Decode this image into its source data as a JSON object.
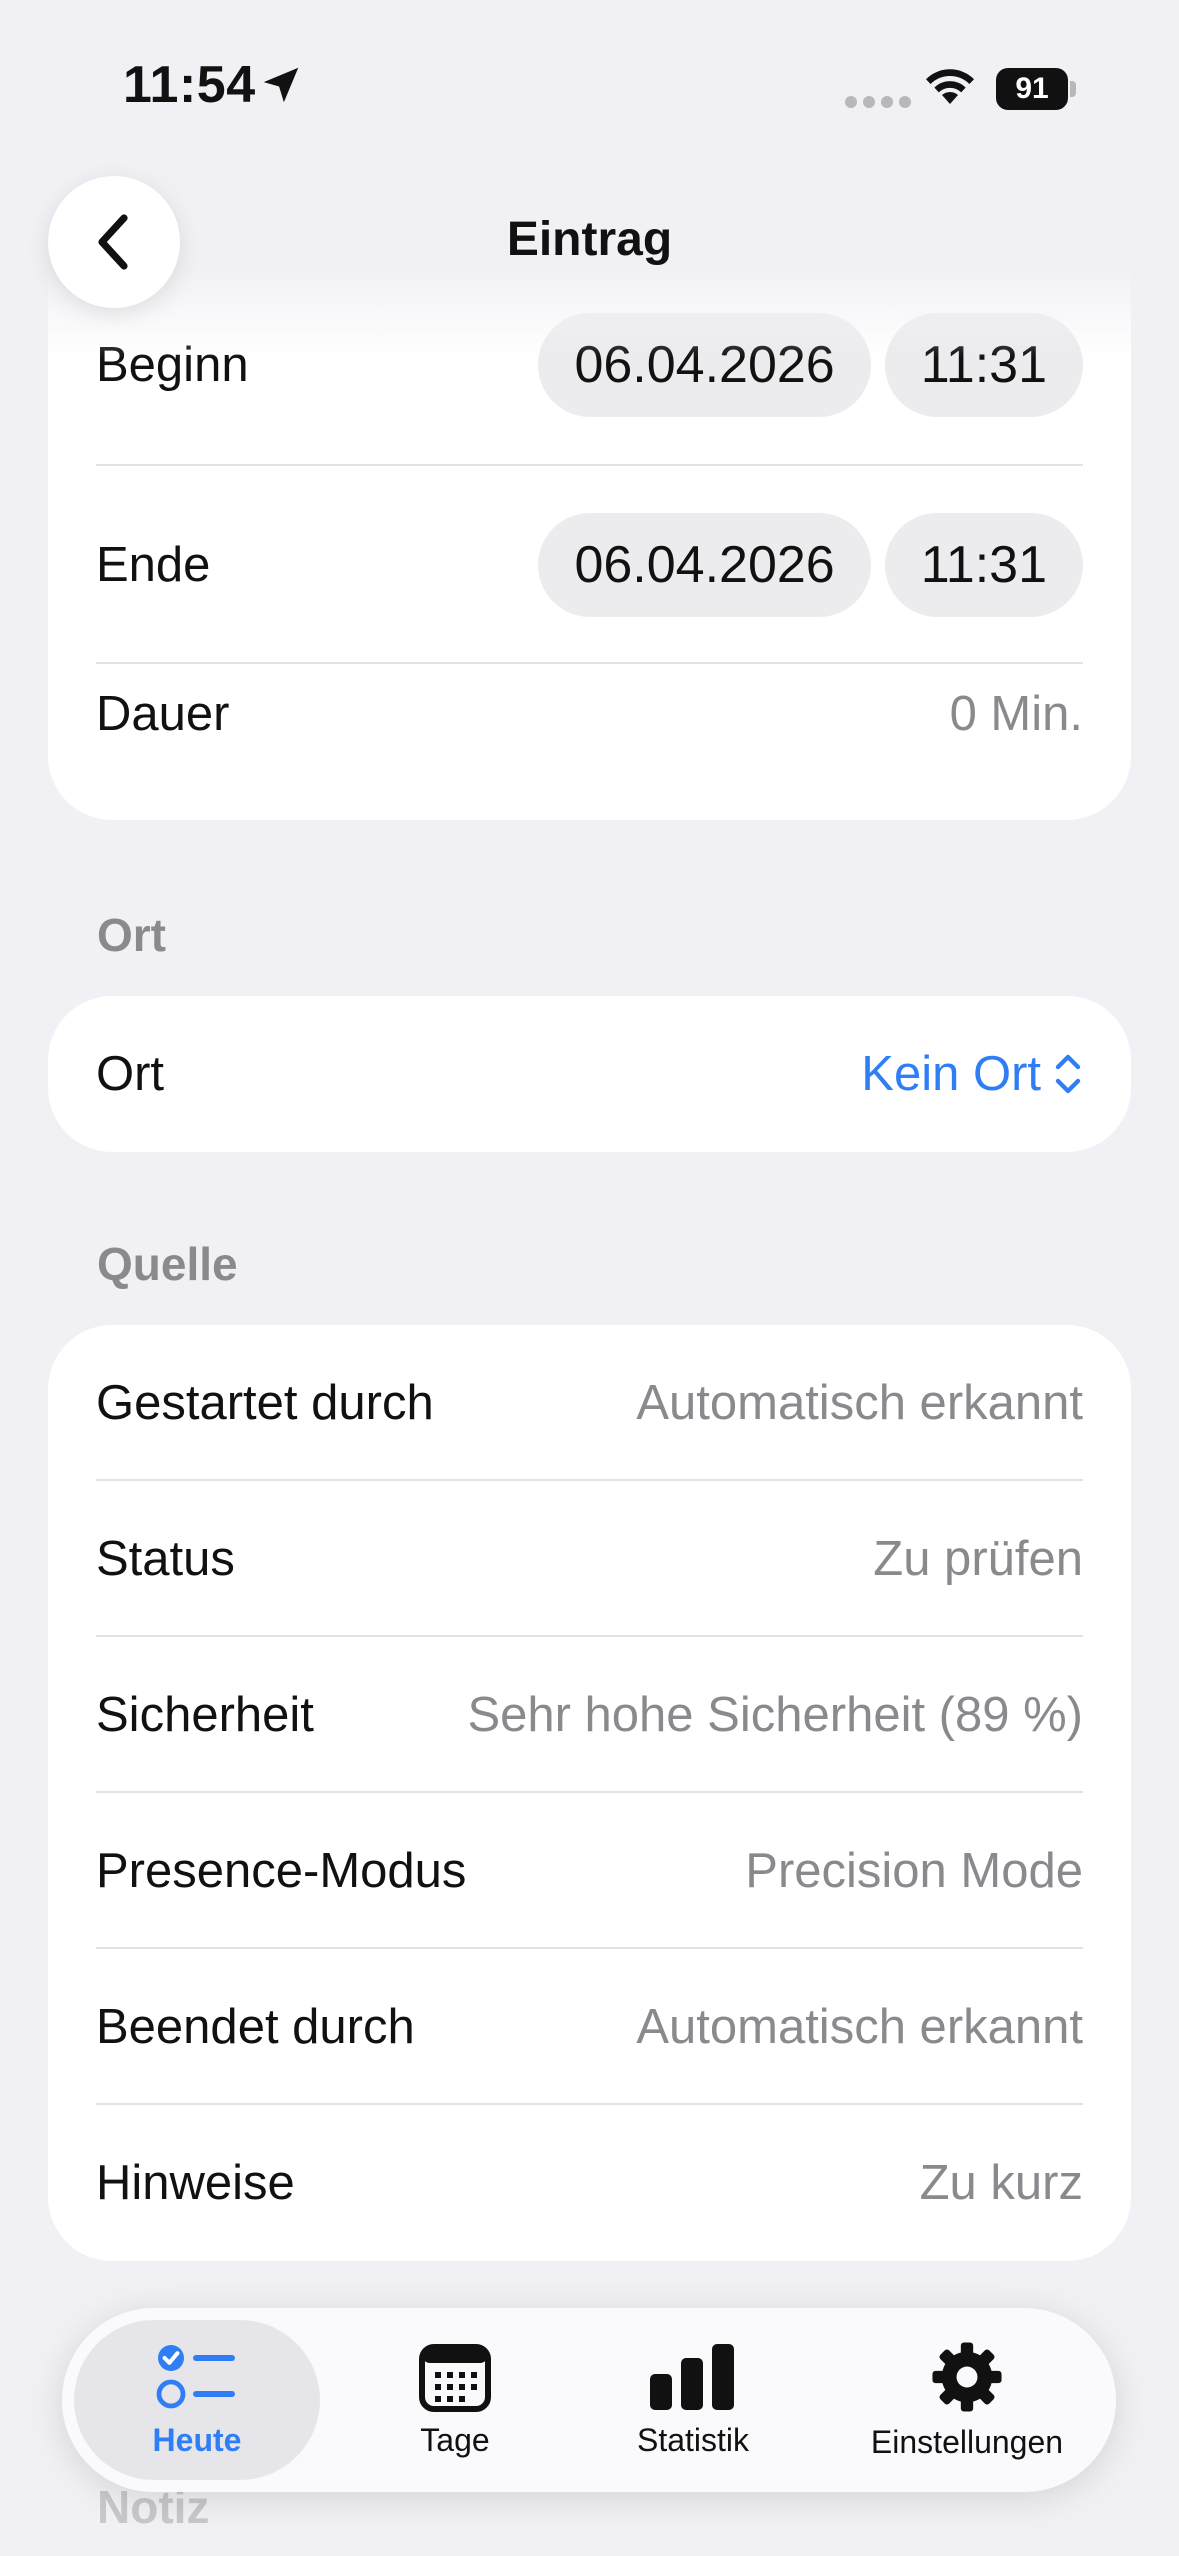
{
  "status_bar": {
    "time": "11:54",
    "battery": "91",
    "icons": [
      "location-arrow-icon",
      "cellular-signal-icon",
      "wifi-icon",
      "battery-icon"
    ]
  },
  "nav": {
    "title": "Eintrag",
    "back_icon": "chevron-left-icon"
  },
  "times": {
    "start": {
      "label": "Beginn",
      "date": "06.04.2026",
      "time": "11:31"
    },
    "end": {
      "label": "Ende",
      "date": "06.04.2026",
      "time": "11:31"
    },
    "duration": {
      "label": "Dauer",
      "value": "0 Min."
    }
  },
  "place_section": {
    "header": "Ort",
    "label": "Ort",
    "value": "Kein Ort",
    "picker_icon": "chevron-up-down-icon"
  },
  "source_section": {
    "header": "Quelle",
    "rows": [
      {
        "label": "Gestartet durch",
        "value": "Automatisch erkannt"
      },
      {
        "label": "Status",
        "value": "Zu prüfen"
      },
      {
        "label": "Sicherheit",
        "value": "Sehr hohe Sicherheit (89 %)"
      },
      {
        "label": "Presence-Modus",
        "value": "Precision Mode"
      },
      {
        "label": "Beendet durch",
        "value": "Automatisch erkannt"
      },
      {
        "label": "Hinweise",
        "value": "Zu kurz"
      }
    ]
  },
  "next_section_header": "Notiz",
  "tabbar": {
    "active": "Heute",
    "tabs": [
      {
        "label": "Heute",
        "icon": "checklist-icon"
      },
      {
        "label": "Tage",
        "icon": "calendar-icon"
      },
      {
        "label": "Statistik",
        "icon": "bar-chart-icon"
      },
      {
        "label": "Einstellungen",
        "icon": "gear-icon"
      }
    ]
  },
  "colors": {
    "accent": "#2f7ef6",
    "background": "#f1f1f5",
    "card": "#ffffff",
    "secondary_text": "#8a8a8e"
  }
}
